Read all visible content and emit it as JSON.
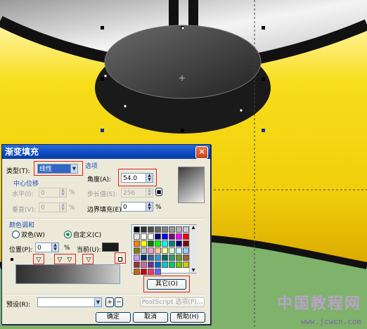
{
  "dialog": {
    "title": "渐变填充",
    "type_label": "类型(T):",
    "type_value": "线性",
    "options_title": "选项",
    "angle_label": "角度(A):",
    "angle_value": "54.0",
    "steps_label": "步长值(S):",
    "steps_value": "256",
    "edge_pad_label": "边界填充(E):",
    "edge_pad_value": "0",
    "edge_pad_unit": "%",
    "center_offset_title": "中心位移",
    "horizontal_label": "水平(I):",
    "horizontal_value": "0",
    "horizontal_unit": "%",
    "vertical_label": "垂直(V):",
    "vertical_value": "0",
    "vertical_unit": "%",
    "color_blend_title": "颜色调和",
    "two_color_label": "双色(W)",
    "custom_label": "自定义(C)",
    "position_label": "位置(P):",
    "position_value": "0",
    "position_unit": "%",
    "current_label": "当前(U):",
    "others_button": "其它(O)",
    "preset_label": "预设(R):",
    "postscript_button": "PostScript 选项(P)...",
    "ok_button": "确定",
    "cancel_button": "取消",
    "help_button": "帮助(H)"
  },
  "palette_colors": [
    "#000000",
    "#333333",
    "#4d4d4d",
    "#666666",
    "#808080",
    "#999999",
    "#b3b3b3",
    "#cccccc",
    "#e6e6e6",
    "#ffffff",
    "#ffffff",
    "#000080",
    "#0000ff",
    "#800080",
    "#ff00ff",
    "#ff0000",
    "#ff8000",
    "#ffff00",
    "#008000",
    "#00ff00",
    "#00ffff",
    "#008080",
    "#000080",
    "#800000",
    "#808000",
    "#c0c0c0",
    "#ff99cc",
    "#ffcc99",
    "#ffff99",
    "#ccffcc",
    "#ccffff",
    "#99ccff",
    "#cc99ff",
    "#003366",
    "#336699",
    "#3399cc",
    "#006666",
    "#339966",
    "#669933",
    "#996633",
    "#993333",
    "#cc6699",
    "#663399",
    "#0066cc",
    "#00cccc",
    "#00cc66",
    "#66cc00",
    "#cccc00",
    "#cc6600",
    "#cc0000",
    "#ff3366",
    "#6666ff"
  ],
  "watermark": {
    "text": "中国教程网",
    "url": "www.jcwcn.com"
  }
}
